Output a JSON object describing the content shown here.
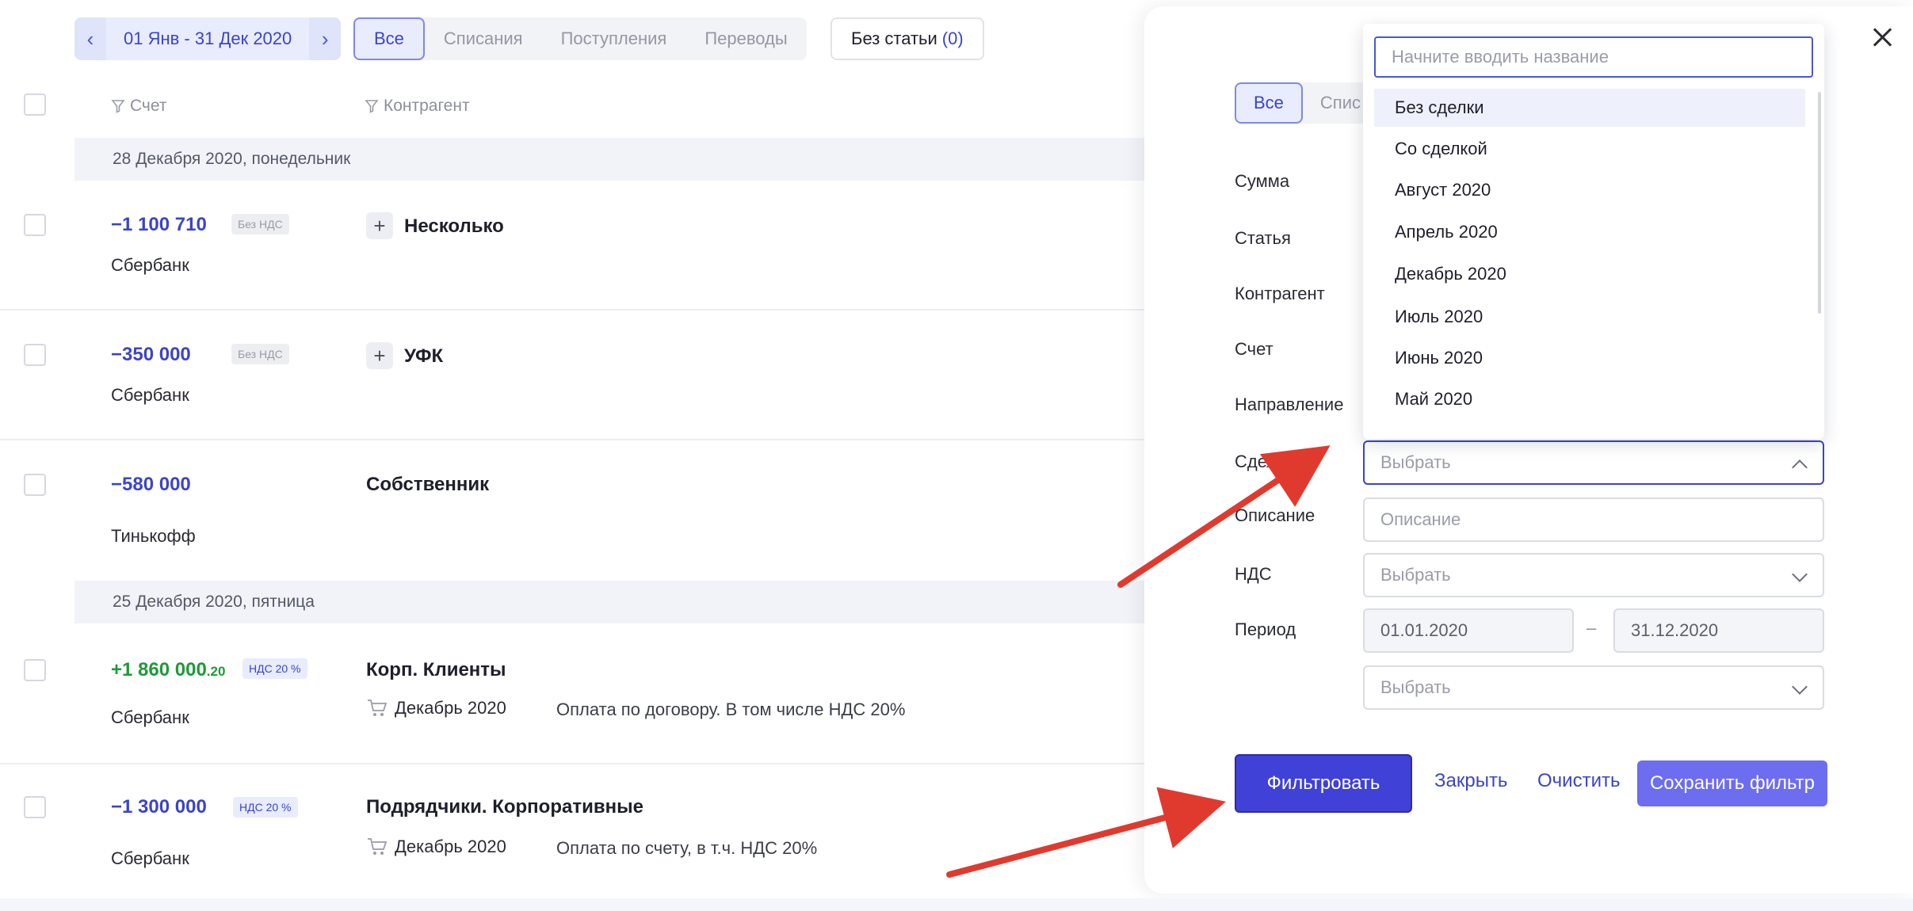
{
  "toolbar": {
    "date_range": "01 Янв - 31 Дек 2020",
    "filter_tabs": [
      "Все",
      "Списания",
      "Поступления",
      "Переводы"
    ],
    "no_article_label": "Без статьи",
    "no_article_count": "(0)"
  },
  "table": {
    "columns": {
      "account": "Счет",
      "counterparty": "Контрагент"
    },
    "days": [
      {
        "label": "28 Декабря 2020, понедельник"
      },
      {
        "label": "25 Декабря 2020, пятница"
      }
    ],
    "rows": [
      {
        "amount": "−1 100 710",
        "cents": "",
        "vat": "Без НДС",
        "bank": "Сбербанк",
        "counterparty": "Несколько",
        "deal": "",
        "description": ""
      },
      {
        "amount": "−350 000",
        "cents": "",
        "vat": "Без НДС",
        "bank": "Сбербанк",
        "counterparty": "УФК",
        "deal": "",
        "description": ""
      },
      {
        "amount": "−580 000",
        "cents": "",
        "vat": "",
        "bank": "Тинькофф",
        "counterparty": "Собственник",
        "deal": "",
        "description": ""
      },
      {
        "amount": "+1 860 000",
        "cents": ".20",
        "vat": "НДС 20 %",
        "bank": "Сбербанк",
        "counterparty": "Корп. Клиенты",
        "deal": "Декабрь 2020",
        "description": "Оплата по договору. В том числе НДС 20%"
      },
      {
        "amount": "−1 300 000",
        "cents": "",
        "vat": "НДС 20 %",
        "bank": "Сбербанк",
        "counterparty": "Подрядчики. Корпоративные",
        "deal": "Декабрь 2020",
        "description": "Оплата по счету, в т.ч. НДС 20%"
      }
    ]
  },
  "filter_panel": {
    "type_tabs": [
      "Все",
      "Спис"
    ],
    "labels": {
      "sum": "Сумма",
      "article": "Статья",
      "counterparty": "Контрагент",
      "account": "Счет",
      "direction": "Направление",
      "deal": "Сделка",
      "description": "Описание",
      "vat": "НДС",
      "period": "Период"
    },
    "deal_placeholder": "Выбрать",
    "description_placeholder": "Описание",
    "vat_placeholder": "Выбрать",
    "period_from": "01.01.2020",
    "period_to": "31.12.2020",
    "period_dash": "–",
    "extra_select_placeholder": "Выбрать",
    "buttons": {
      "filter": "Фильтровать",
      "close": "Закрыть",
      "clear": "Очистить",
      "save": "Сохранить фильтр"
    },
    "deal_dropdown": {
      "search_placeholder": "Начните вводить название",
      "options": [
        "Без сделки",
        "Со сделкой",
        "Август 2020",
        "Апрель 2020",
        "Декабрь 2020",
        "Июль 2020",
        "Июнь 2020",
        "Май 2020"
      ],
      "highlighted": "Без сделки"
    }
  },
  "colors": {
    "accent": "#3b44c9",
    "primary_button": "#4041d6",
    "positive": "#1d9a3a",
    "annotation_arrow": "#e03a2e"
  }
}
